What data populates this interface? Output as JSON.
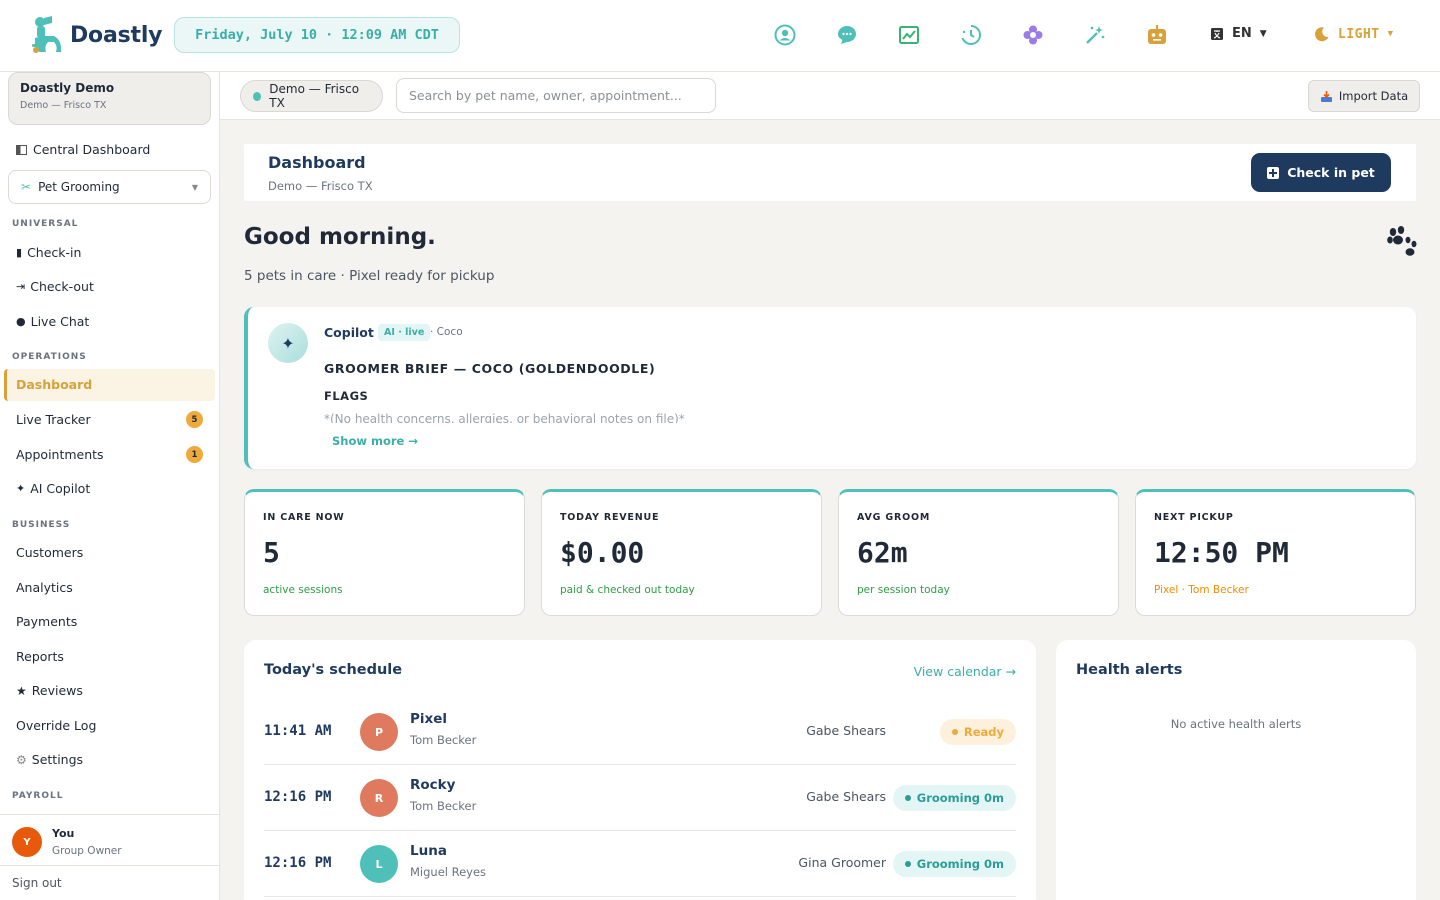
{
  "app": {
    "brand": "Doastly",
    "datetime": "Friday, July 10 · 12:09 AM CDT",
    "language": "EN",
    "theme": "LIGHT",
    "top_icons": [
      "user-circle-icon",
      "chat-bubble-icon",
      "chart-icon",
      "clock-history-icon",
      "flower-icon",
      "magic-wand-icon",
      "robot-icon"
    ]
  },
  "colors": {
    "accent_teal": "#4fbfba",
    "navy": "#1f3a5f",
    "gold": "#d8a13a",
    "orange_badge": "#f0a93b"
  },
  "sidebar": {
    "org_name": "Doastly Demo",
    "org_location": "Demo — Frisco TX",
    "central": "Central Dashboard",
    "vertical": "Pet Grooming",
    "sections": {
      "universal": "UNIVERSAL",
      "operations": "OPERATIONS",
      "business": "BUSINESS",
      "payroll": "PAYROLL"
    },
    "universal_items": [
      "Check-in",
      "Check-out",
      "Live Chat"
    ],
    "operations_items": [
      {
        "label": "Dashboard",
        "active": true
      },
      {
        "label": "Live Tracker",
        "badge": "5"
      },
      {
        "label": "Appointments",
        "badge": "1"
      },
      {
        "label": "AI Copilot"
      }
    ],
    "business_items": [
      "Customers",
      "Analytics",
      "Payments",
      "Reports",
      "Reviews",
      "Override Log",
      "Settings"
    ],
    "user": {
      "initial": "Y",
      "name": "You",
      "role": "Group Owner"
    },
    "sign_out": "Sign out"
  },
  "subbar": {
    "location": "Demo — Frisco TX",
    "search_placeholder": "Search by pet name, owner, appointment...",
    "import_label": "Import Data"
  },
  "header": {
    "title": "Dashboard",
    "subtitle": "Demo — Frisco TX",
    "checkin_label": "Check in pet"
  },
  "greeting": {
    "title": "Good morning.",
    "subtitle": "5 pets in care · Pixel ready for pickup"
  },
  "copilot": {
    "name": "Copilot",
    "tag": "AI · live",
    "pet": "· Coco",
    "brief_title": "GROOMER BRIEF — COCO (GOLDENDOODLE)",
    "flags_label": "FLAGS",
    "flags_note": "*(No health concerns, allergies, or behavioral notes on file)*",
    "show_more": "Show more →"
  },
  "stats": [
    {
      "label": "IN CARE NOW",
      "value": "5",
      "sub": "active sessions",
      "tone": "green"
    },
    {
      "label": "TODAY REVENUE",
      "value": "$0.00",
      "sub": "paid & checked out today",
      "tone": "green"
    },
    {
      "label": "AVG GROOM",
      "value": "62m",
      "sub": "per session today",
      "tone": "green"
    },
    {
      "label": "NEXT PICKUP",
      "value": "12:50 PM",
      "sub": "Pixel · Tom Becker",
      "tone": "orange"
    }
  ],
  "schedule": {
    "title": "Today's schedule",
    "view_calendar": "View calendar →",
    "rows": [
      {
        "time": "11:41 AM",
        "initial": "P",
        "pet": "Pixel",
        "owner": "Tom Becker",
        "groomer": "Gabe Shears",
        "status": "Ready",
        "status_kind": "ready",
        "avatar_color": "#e07a5f"
      },
      {
        "time": "12:16 PM",
        "initial": "R",
        "pet": "Rocky",
        "owner": "Tom Becker",
        "groomer": "Gabe Shears",
        "status": "Grooming 0m",
        "status_kind": "groom",
        "avatar_color": "#e07a5f"
      },
      {
        "time": "12:16 PM",
        "initial": "L",
        "pet": "Luna",
        "owner": "Miguel Reyes",
        "groomer": "Gina Groomer",
        "status": "Grooming 0m",
        "status_kind": "groom",
        "avatar_color": "#4fbfba"
      }
    ]
  },
  "health_alerts": {
    "title": "Health alerts",
    "empty": "No active health alerts"
  }
}
